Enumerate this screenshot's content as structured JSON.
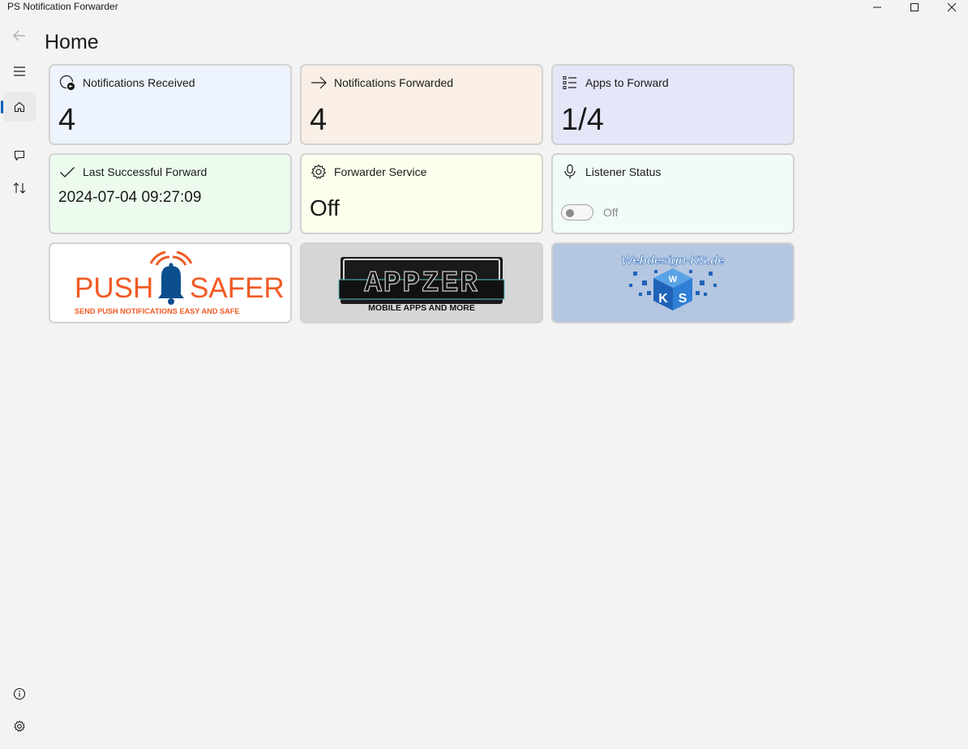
{
  "window": {
    "title": "PS Notification Forwarder"
  },
  "page": {
    "title": "Home"
  },
  "cards": {
    "received": {
      "label": "Notifications Received",
      "value": "4"
    },
    "forwarded": {
      "label": "Notifications Forwarded",
      "value": "4"
    },
    "apps": {
      "label": "Apps to Forward",
      "value": "1/4"
    },
    "last": {
      "label": "Last Successful Forward",
      "value": "2024-07-04 09:27:09"
    },
    "service": {
      "label": "Forwarder Service",
      "value": "Off"
    },
    "listener": {
      "label": "Listener Status",
      "toggle_label": "Off"
    }
  },
  "logos": {
    "pushsafer": {
      "left": "PUSH",
      "right": "SAFER",
      "tagline": "SEND PUSH NOTIFICATIONS EASY AND SAFE"
    },
    "appzer": {
      "name": "APPZER",
      "tagline": "MOBILE APPS AND MORE"
    },
    "webdesign": {
      "name": "Webdesign-KS.de",
      "letters": "WKS"
    }
  },
  "icons": {
    "back": "back-arrow-icon",
    "menu": "hamburger-menu-icon",
    "home": "home-icon",
    "chat": "chat-bubble-icon",
    "transfer": "up-down-arrows-icon",
    "info": "info-icon",
    "settings": "gear-icon"
  },
  "colors": {
    "accent": "#005fb8",
    "card_received": "#eef4fd",
    "card_forwarded": "#f9efe6",
    "card_apps": "#e5e6f8",
    "card_last": "#edfbef",
    "card_service": "#fefeec",
    "card_listener": "#f1fcf9",
    "card_pushsafer": "#ffffff",
    "card_appzer": "#d6d6d6",
    "card_webdesign": "#b4c6e0"
  }
}
